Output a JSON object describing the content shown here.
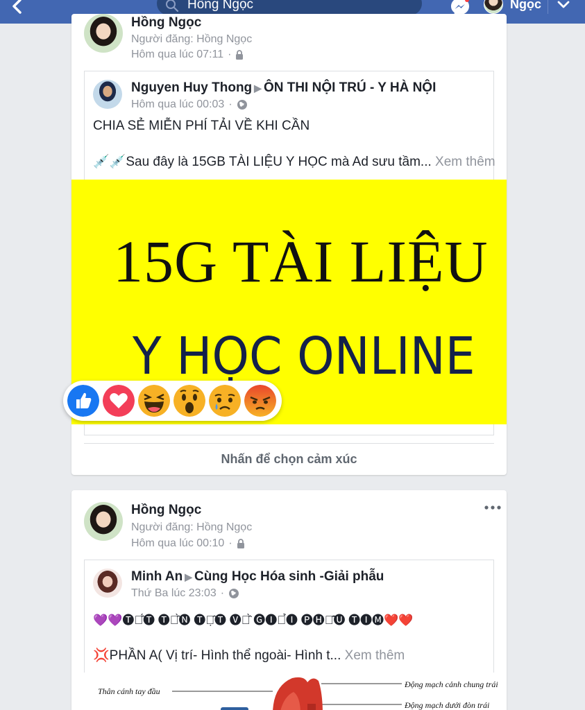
{
  "topbar": {
    "search_text": "Hồng Ngọc",
    "user_name": "Ngọc"
  },
  "post1": {
    "author": "Hồng Ngọc",
    "posted_by": "Người đăng: Hồng Ngọc",
    "time": "Hôm qua lúc 07:11",
    "shared": {
      "author": "Nguyen Huy Thong",
      "group": "ÔN THI NỘI TRÚ - Y HÀ NỘI",
      "time": "Hôm qua lúc 00:03",
      "line1": "CHIA SẺ MIỄN PHÍ TẢI VỀ KHI CẦN",
      "line2_emoji": "💉💉",
      "line2": "Sau đây là 15GB TÀI LIỆU Y HỌC mà Ad sưu tầm...",
      "see_more": "Xem thêm",
      "image_line1": "15G TÀI LIỆU",
      "image_line2": "Y HỌC ONLINE"
    },
    "reactions": [
      "like",
      "love",
      "haha",
      "wow",
      "sad",
      "angry"
    ],
    "reaction_hint": "Nhấn để chọn cảm xúc"
  },
  "post2": {
    "author": "Hồng Ngọc",
    "posted_by": "Người đăng: Hồng Ngọc",
    "time": "Hôm qua lúc 00:10",
    "shared": {
      "author": "Minh An",
      "group": "Cùng Học Hóa sinh -Giải phẫu",
      "time": "Thứ Ba lúc 23:03",
      "line1": "💜💜🅣🅐̂́🅣 🅣🅐̂̀🅝 🅣🅐̣̂🅣 🅥🅔̂̀ 🅖🅘🅐̉🅘 🅟🅗🅐̂̃🅤 🅣🅘🅜❤️❤️",
      "line2_emoji": "💢",
      "line2": "PHẦN A( Vị trí- Hình thể ngoài- Hình t...",
      "see_more": "Xem thêm",
      "diagram_labels": {
        "left": "Thân cánh tay đầu",
        "right_top": "Động mạch cảnh chung trái",
        "right_bottom": "Động mạch dưới đòn trái"
      }
    }
  },
  "colors": {
    "fb_blue": "#4267b2",
    "banner_yellow": "#ffff00",
    "like_blue": "#1877f2",
    "love_red": "#f33e58"
  }
}
